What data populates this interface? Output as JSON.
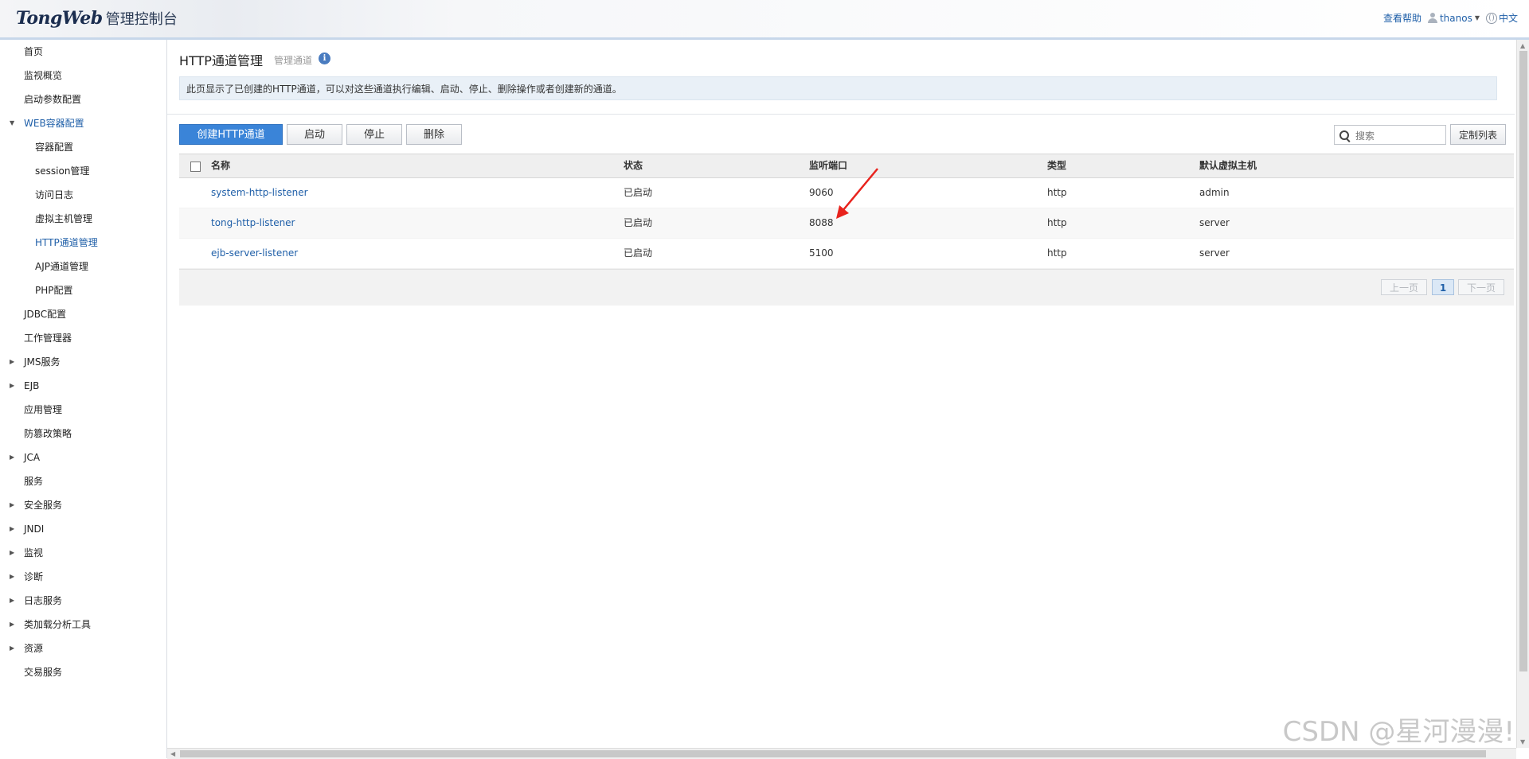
{
  "header": {
    "logo_brand": "TongWeb",
    "logo_console": "管理控制台",
    "help": "查看帮助",
    "user": "thanos",
    "language": "中文"
  },
  "sidebar": {
    "items": [
      {
        "label": "首页"
      },
      {
        "label": "监视概览"
      },
      {
        "label": "启动参数配置"
      },
      {
        "label": "WEB容器配置"
      },
      {
        "label": "容器配置"
      },
      {
        "label": "session管理"
      },
      {
        "label": "访问日志"
      },
      {
        "label": "虚拟主机管理"
      },
      {
        "label": "HTTP通道管理"
      },
      {
        "label": "AJP通道管理"
      },
      {
        "label": "PHP配置"
      },
      {
        "label": "JDBC配置"
      },
      {
        "label": "工作管理器"
      },
      {
        "label": "JMS服务"
      },
      {
        "label": "EJB"
      },
      {
        "label": "应用管理"
      },
      {
        "label": "防篡改策略"
      },
      {
        "label": "JCA"
      },
      {
        "label": "服务"
      },
      {
        "label": "安全服务"
      },
      {
        "label": "JNDI"
      },
      {
        "label": "监视"
      },
      {
        "label": "诊断"
      },
      {
        "label": "日志服务"
      },
      {
        "label": "类加载分析工具"
      },
      {
        "label": "资源"
      },
      {
        "label": "交易服务"
      }
    ]
  },
  "page": {
    "title": "HTTP通道管理",
    "subtitle": "管理通道",
    "description": "此页显示了已创建的HTTP通道，可以对这些通道执行编辑、启动、停止、删除操作或者创建新的通道。"
  },
  "toolbar": {
    "create": "创建HTTP通道",
    "start": "启动",
    "stop": "停止",
    "delete": "删除",
    "search_placeholder": "搜索",
    "customize": "定制列表"
  },
  "table": {
    "headers": {
      "name": "名称",
      "status": "状态",
      "port": "监听端口",
      "type": "类型",
      "vhost": "默认虚拟主机"
    },
    "rows": [
      {
        "name": "system-http-listener",
        "status": "已启动",
        "port": "9060",
        "type": "http",
        "vhost": "admin"
      },
      {
        "name": "tong-http-listener",
        "status": "已启动",
        "port": "8088",
        "type": "http",
        "vhost": "server"
      },
      {
        "name": "ejb-server-listener",
        "status": "已启动",
        "port": "5100",
        "type": "http",
        "vhost": "server"
      }
    ]
  },
  "pager": {
    "prev": "上一页",
    "current": "1",
    "next": "下一页"
  },
  "watermark": "CSDN @星河漫漫!",
  "colors": {
    "accent": "#1f5fa8",
    "primary_button": "#3a84d8",
    "annotation_arrow": "#e8231d"
  }
}
